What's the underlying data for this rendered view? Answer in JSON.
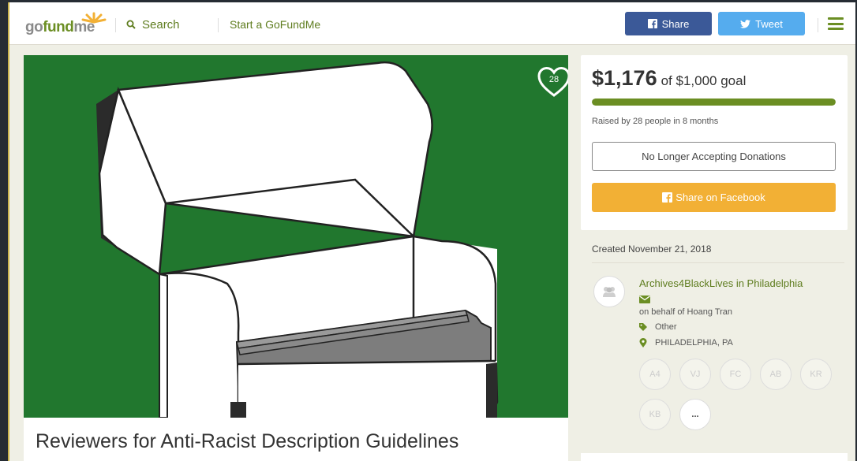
{
  "header": {
    "logo": "gofundme",
    "search_label": "Search",
    "start_label": "Start a GoFundMe",
    "share_label": "Share",
    "tweet_label": "Tweet"
  },
  "campaign": {
    "title": "Reviewers for Anti-Racist Description Guidelines",
    "heart_count": "28",
    "raised": "$1,176",
    "goal_text": "of $1,000 goal",
    "progress_fraction": 1.0,
    "raised_by": "Raised by 28 people in 8 months",
    "no_donations_label": "No Longer Accepting Donations",
    "share_fb_label": "Share on Facebook",
    "created": "Created November 21, 2018",
    "organizer": "Archives4BlackLives in Philadelphia",
    "on_behalf": "on behalf of Hoang Tran",
    "category": "Other",
    "location": "PHILADELPHIA, PA",
    "donors": [
      "A4",
      "VJ",
      "FC",
      "AB",
      "KR",
      "KB",
      "..."
    ]
  },
  "colors": {
    "brand_green": "#6b8e23",
    "hero_bg": "#21772e",
    "facebook": "#3b5998",
    "twitter": "#55acee",
    "share_orange": "#f2b035"
  }
}
